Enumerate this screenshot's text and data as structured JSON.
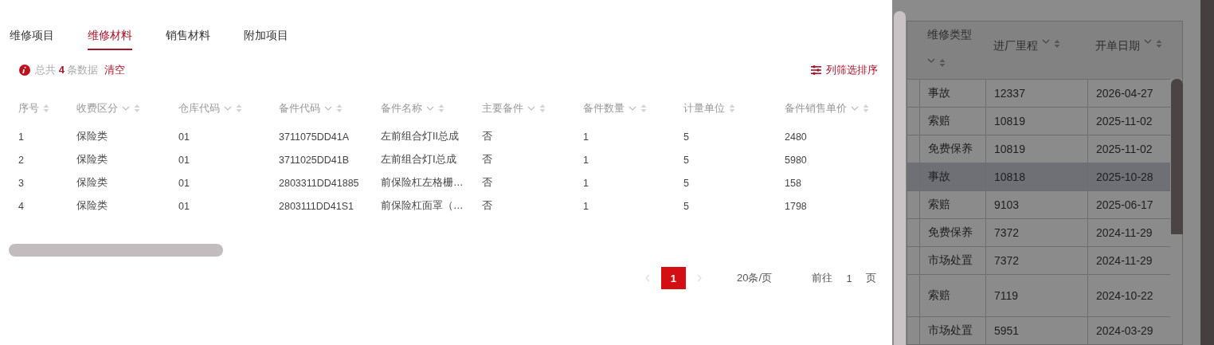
{
  "tabs": [
    {
      "label": "维修项目",
      "selected": false
    },
    {
      "label": "维修材料",
      "selected": true
    },
    {
      "label": "销售材料",
      "selected": false
    },
    {
      "label": "附加项目",
      "selected": false
    }
  ],
  "summary": {
    "prefix": "总共",
    "count": "4",
    "suffix": "条数据",
    "clear": "清空"
  },
  "column_filter": "列筛选排序",
  "table": {
    "columns": [
      {
        "label": "序号",
        "filter": false
      },
      {
        "label": "收费区分",
        "filter": true
      },
      {
        "label": "仓库代码",
        "filter": true
      },
      {
        "label": "备件代码",
        "filter": true
      },
      {
        "label": "备件名称",
        "filter": true
      },
      {
        "label": "主要备件",
        "filter": true
      },
      {
        "label": "备件数量",
        "filter": true
      },
      {
        "label": "计量单位",
        "filter": false
      },
      {
        "label": "备件销售单价",
        "filter": true
      }
    ],
    "rows": [
      [
        "1",
        "保险类",
        "01",
        "3711075DD41A",
        "左前组合灯II总成",
        "否",
        "1",
        "5",
        "2480"
      ],
      [
        "2",
        "保险类",
        "01",
        "3711025DD41B",
        "左前组合灯Ⅰ总成",
        "否",
        "1",
        "5",
        "5980"
      ],
      [
        "3",
        "保险类",
        "01",
        "2803311DD41885",
        "前保险杠左格栅…",
        "否",
        "1",
        "5",
        "158"
      ],
      [
        "4",
        "保险类",
        "01",
        "2803111DD41S1",
        "前保险杠面罩（…",
        "否",
        "1",
        "5",
        "1798"
      ]
    ]
  },
  "pagination": {
    "pages": [
      {
        "label": "1",
        "selected": true
      }
    ],
    "page_size": "20条/页",
    "goto_label": "前往",
    "goto_value": "1",
    "goto_unit": "页"
  },
  "background_table": {
    "columns": [
      {
        "label": "维修类型",
        "filter": true
      },
      {
        "label": "进厂里程",
        "filter": true
      },
      {
        "label": "开单日期",
        "filter": true
      }
    ],
    "rows": [
      {
        "cells": [
          "事故",
          "12337",
          "2026-04-27"
        ],
        "selected": false
      },
      {
        "cells": [
          "索赔",
          "10819",
          "2025-11-02"
        ],
        "selected": false
      },
      {
        "cells": [
          "免费保养",
          "10819",
          "2025-11-02"
        ],
        "selected": false
      },
      {
        "cells": [
          "事故",
          "10818",
          "2025-10-28"
        ],
        "selected": true
      },
      {
        "cells": [
          "索赔",
          "9103",
          "2025-06-17"
        ],
        "selected": false
      },
      {
        "cells": [
          "免费保养",
          "7372",
          "2024-11-29"
        ],
        "selected": false
      },
      {
        "cells": [
          "市场处置",
          "7372",
          "2024-11-29"
        ],
        "selected": false
      },
      {
        "cells": [
          "索赔",
          "7119",
          "2024-10-22"
        ],
        "selected": false
      },
      {
        "cells": [
          "市场处置",
          "5951",
          "2024-03-29"
        ],
        "selected": false
      }
    ]
  }
}
